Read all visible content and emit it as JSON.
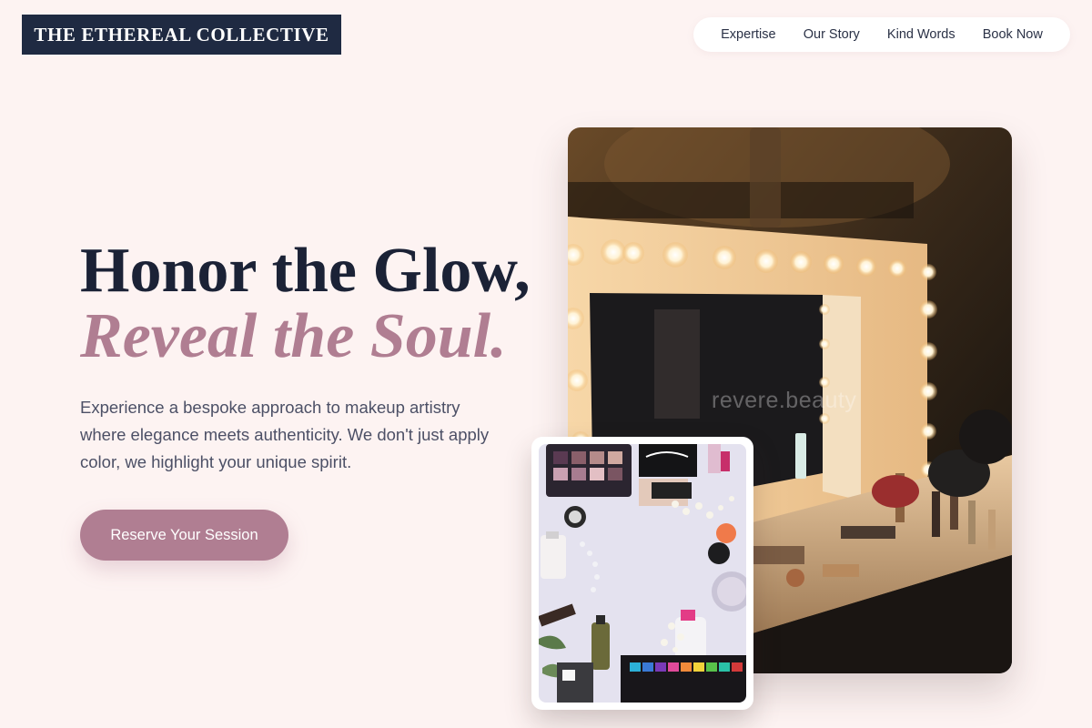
{
  "brand": {
    "name": "THE ETHEREAL COLLECTIVE"
  },
  "nav": {
    "items": [
      {
        "label": "Expertise"
      },
      {
        "label": "Our Story"
      },
      {
        "label": "Kind Words"
      },
      {
        "label": "Book Now"
      }
    ]
  },
  "hero": {
    "headline_line1": "Honor the Glow,",
    "headline_line2": "Reveal the Soul.",
    "lead": "Experience a bespoke approach to makeup artistry where elegance meets authenticity. We don't just apply color, we highlight your unique spirit.",
    "cta_label": "Reserve Your Session"
  },
  "images": {
    "main_alt": "vanity mirror with lights",
    "main_watermark": "revere.beauty",
    "small_alt": "makeup products flat lay"
  },
  "colors": {
    "background": "#fdf3f2",
    "navy": "#1f2a42",
    "accent": "#b07e92",
    "text": "#4c5066"
  }
}
